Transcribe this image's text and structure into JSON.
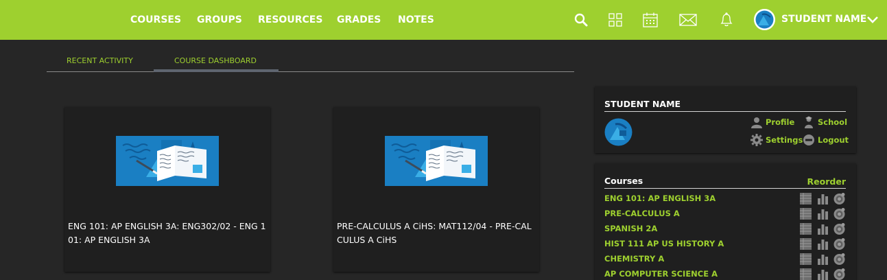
{
  "nav": {
    "items": [
      "COURSES",
      "GROUPS",
      "RESOURCES",
      "GRADES",
      "NOTES"
    ],
    "user_name": "STUDENT NAME",
    "icons": [
      "search-icon",
      "apps-grid-icon",
      "calendar-icon",
      "mail-icon",
      "notifications-icon"
    ]
  },
  "tabs": [
    {
      "label": "RECENT ACTIVITY",
      "active": false
    },
    {
      "label": "COURSE DASHBOARD",
      "active": true
    }
  ],
  "courses_cards": [
    {
      "title": "ENG 101: AP ENGLISH 3A: ENG302/02 - ENG 101: AP ENGLISH 3A"
    },
    {
      "title": "PRE-CALCULUS A CiHS: MAT112/04 - PRE-CALCULUS A CiHS"
    }
  ],
  "profile_panel": {
    "name": "STUDENT NAME",
    "links": {
      "profile": "Profile",
      "school": "School",
      "settings": "Settings",
      "logout": "Logout"
    }
  },
  "courses_panel": {
    "title": "Courses",
    "reorder": "Reorder",
    "items": [
      "ENG 101: AP ENGLISH 3A",
      "PRE-CALCULUS A",
      "SPANISH 2A",
      "HIST 111 AP US HISTORY A",
      "CHEMISTRY A",
      "AP COMPUTER SCIENCE A"
    ],
    "row_icons": [
      "gradebook-icon",
      "bar-chart-icon",
      "alerts-icon"
    ]
  },
  "colors": {
    "accent": "#9ed02f",
    "background": "#262626",
    "card": "#1f1f1f",
    "thumb_blue": "#1a7fc3"
  }
}
